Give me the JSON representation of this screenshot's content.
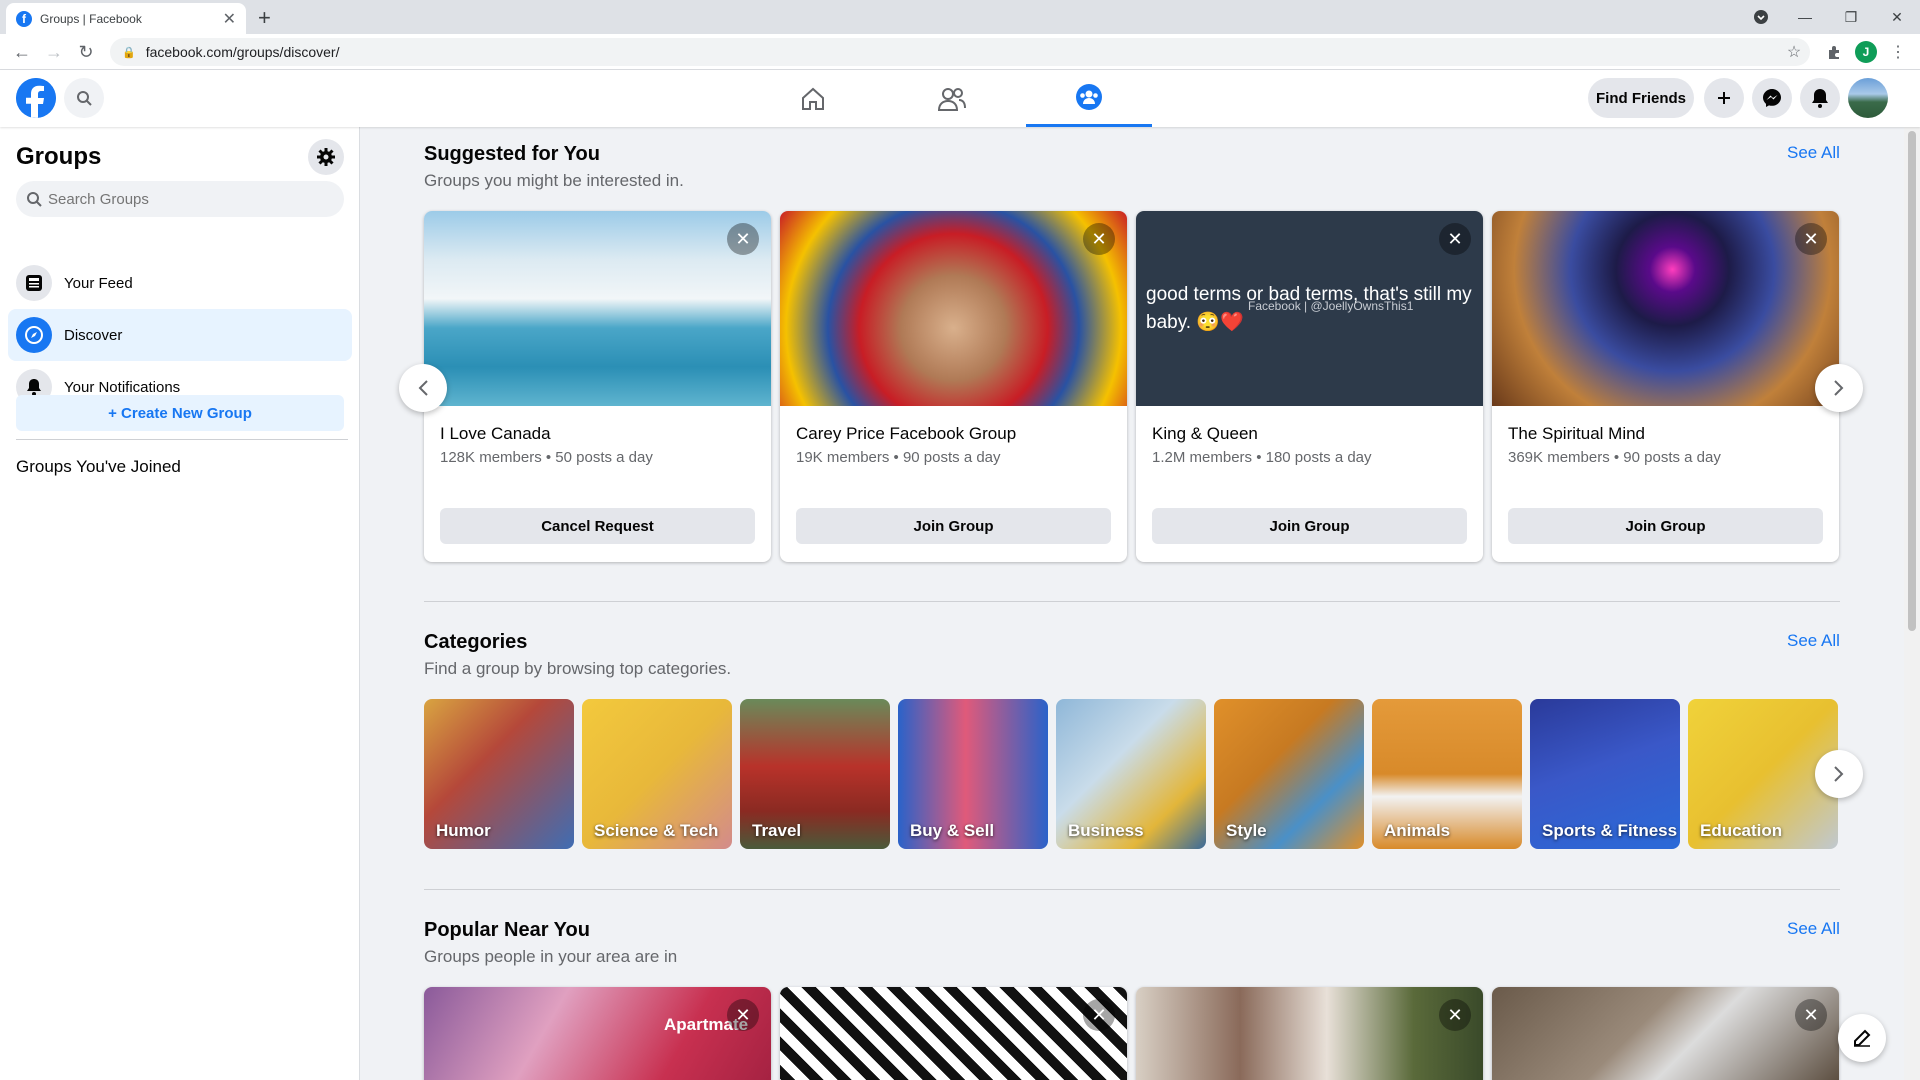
{
  "browser": {
    "tab_title": "Groups | Facebook",
    "url": "facebook.com/groups/discover/",
    "profile_initial": "J"
  },
  "header": {
    "find_friends": "Find Friends",
    "active_tab": "groups"
  },
  "sidebar": {
    "title": "Groups",
    "search_placeholder": "Search Groups",
    "items": [
      {
        "label": "Your Feed",
        "icon": "feed-icon"
      },
      {
        "label": "Discover",
        "icon": "compass-icon",
        "active": true
      },
      {
        "label": "Your Notifications",
        "icon": "bell-icon"
      }
    ],
    "create_button": "+ Create New Group",
    "joined_title": "Groups You've Joined"
  },
  "suggested": {
    "title": "Suggested for You",
    "subtitle": "Groups you might be interested in.",
    "see_all": "See All",
    "cards": [
      {
        "name": "I Love Canada",
        "meta": "128K members • 50 posts a day",
        "button": "Cancel Request"
      },
      {
        "name": "Carey Price Facebook Group",
        "meta": "19K members • 90 posts a day",
        "button": "Join Group"
      },
      {
        "name": "King & Queen",
        "meta": "1.2M members • 180 posts a day",
        "button": "Join Group",
        "image_text": "good terms or bad terms, that's still my baby. 😳❤️",
        "image_credit": "Facebook | @JoellyOwnsThis1"
      },
      {
        "name": "The Spiritual Mind",
        "meta": "369K members • 90 posts a day",
        "button": "Join Group"
      }
    ]
  },
  "categories": {
    "title": "Categories",
    "subtitle": "Find a group by browsing top categories.",
    "see_all": "See All",
    "items": [
      "Humor",
      "Science & Tech",
      "Travel",
      "Buy & Sell",
      "Business",
      "Style",
      "Animals",
      "Sports & Fitness",
      "Education"
    ]
  },
  "popular": {
    "title": "Popular Near You",
    "subtitle": "Groups people in your area are in",
    "see_all": "See All",
    "first_card_watermark": "Apartmate"
  },
  "colors": {
    "brand": "#1877f2",
    "secondary_text": "#65676b",
    "button_bg": "#e4e6eb"
  }
}
